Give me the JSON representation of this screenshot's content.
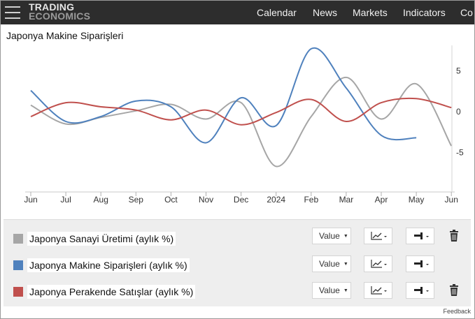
{
  "header": {
    "logo_line1": "TRADING",
    "logo_line2": "ECONOMICS",
    "nav": [
      "Calendar",
      "News",
      "Markets",
      "Indicators",
      "Co"
    ]
  },
  "chart_title": "Japonya Makine Siparişleri",
  "chart_data": {
    "type": "line",
    "title": "Japonya Makine Siparişleri",
    "xlabel": "",
    "ylabel": "",
    "x": [
      "Jun",
      "Jul",
      "Aug",
      "Sep",
      "Oct",
      "Nov",
      "Dec",
      "2024",
      "Feb",
      "Mar",
      "Apr",
      "May",
      "Jun"
    ],
    "ylim": [
      -9,
      8
    ],
    "yticks": [
      5,
      0,
      -5
    ],
    "ytick_labels": [
      "5",
      "0",
      "-5"
    ],
    "grid": false,
    "series": [
      {
        "name": "Japonya Sanayi Üretimi (aylık %)",
        "color": "#a6a6a6",
        "values": [
          0.8,
          -1.5,
          -0.7,
          0.1,
          0.9,
          -0.9,
          1.1,
          -6.7,
          -0.6,
          4.2,
          -0.9,
          3.4,
          -4.2
        ]
      },
      {
        "name": "Japonya Makine Siparişleri (aylık %)",
        "color": "#4f81bd",
        "values": [
          2.6,
          -1.2,
          -0.6,
          1.3,
          0.6,
          -3.8,
          1.7,
          -1.7,
          7.7,
          2.9,
          -2.9,
          -3.2
        ]
      },
      {
        "name": "Japonya Perakende Satışlar (aylık %)",
        "color": "#c0504d",
        "values": [
          -0.6,
          1.1,
          0.6,
          0.2,
          -1.0,
          0.2,
          -1.6,
          -0.1,
          1.5,
          -1.2,
          1.1,
          1.6,
          0.5
        ]
      }
    ]
  },
  "legend": {
    "items": [
      {
        "label": "Japonya Sanayi Üretimi (aylık %)",
        "color": "#a6a6a6",
        "value_btn": "Value",
        "trash": true
      },
      {
        "label": "Japonya Makine Siparişleri (aylık %)",
        "color": "#4f81bd",
        "value_btn": "Value",
        "trash": false
      },
      {
        "label": "Japonya Perakende Satışlar (aylık %)",
        "color": "#c0504d",
        "value_btn": "Value",
        "trash": true
      }
    ]
  },
  "feedback": "Feedback"
}
